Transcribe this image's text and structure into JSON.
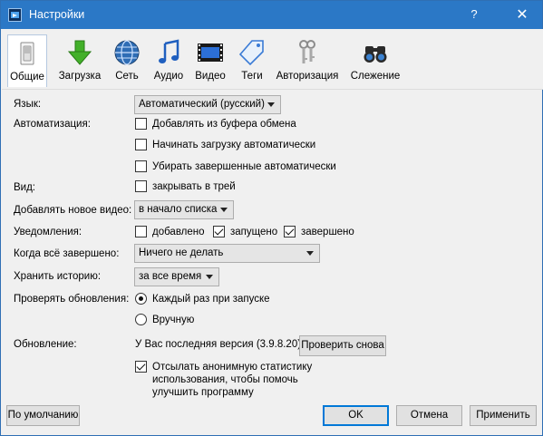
{
  "window": {
    "title": "Настройки",
    "help_glyph": "?",
    "close_glyph": "✕"
  },
  "toolbar": {
    "items": [
      {
        "label": "Общие",
        "icon": "general-switch-icon"
      },
      {
        "label": "Загрузка",
        "icon": "download-arrow-icon"
      },
      {
        "label": "Сеть",
        "icon": "network-globe-icon"
      },
      {
        "label": "Аудио",
        "icon": "music-note-icon"
      },
      {
        "label": "Видео",
        "icon": "film-strip-icon"
      },
      {
        "label": "Теги",
        "icon": "tag-icon"
      },
      {
        "label": "Авторизация",
        "icon": "keys-icon"
      },
      {
        "label": "Слежение",
        "icon": "binoculars-icon"
      }
    ]
  },
  "language": {
    "label": "Язык:",
    "value": "Автоматический (русский)"
  },
  "automation": {
    "label": "Автоматизация:",
    "options": [
      {
        "label": "Добавлять из буфера обмена",
        "checked": false
      },
      {
        "label": "Начинать загрузку автоматически",
        "checked": false
      },
      {
        "label": "Убирать завершенные автоматически",
        "checked": false
      }
    ]
  },
  "view": {
    "label": "Вид:",
    "option": {
      "label": "закрывать в трей",
      "checked": false
    }
  },
  "add_video": {
    "label": "Добавлять новое видео:",
    "value": "в начало списка"
  },
  "notifications": {
    "label": "Уведомления:",
    "options": [
      {
        "label": "добавлено",
        "checked": false
      },
      {
        "label": "запущено",
        "checked": true
      },
      {
        "label": "завершено",
        "checked": true
      }
    ]
  },
  "when_done": {
    "label": "Когда всё завершено:",
    "value": "Ничего не делать"
  },
  "history": {
    "label": "Хранить историю:",
    "value": "за все время"
  },
  "check_updates": {
    "label": "Проверять обновления:",
    "options": [
      {
        "label": "Каждый раз при запуске",
        "checked": true
      },
      {
        "label": "Вручную",
        "checked": false
      }
    ]
  },
  "update": {
    "label": "Обновление:",
    "status": "У Вас последняя версия (3.9.8.20)",
    "check_button": "Проверить снова"
  },
  "stats": {
    "checked": true,
    "line1": "Отсылать анонимную статистику",
    "line2": "использования, чтобы помочь",
    "line3": "улучшить программу"
  },
  "buttons": {
    "defaults": "По умолчанию",
    "ok": "OK",
    "cancel": "Отмена",
    "apply": "Применить"
  }
}
